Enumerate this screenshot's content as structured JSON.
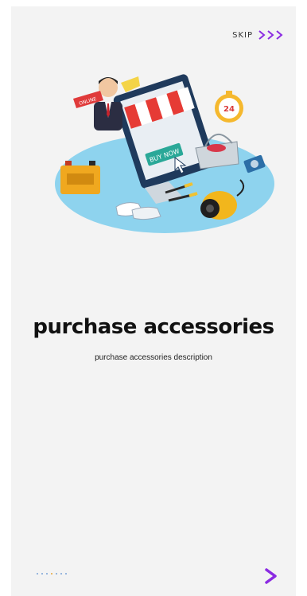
{
  "onboarding": {
    "skip_label": "SKIP",
    "title": "purchase accessories",
    "description": "purchase accessories description"
  },
  "illustration": {
    "online_tag": "ONLINE",
    "buy_now_label": "BUY NOW",
    "clock_number": "24"
  },
  "pagination": {
    "page_count": 7,
    "dot_colors": [
      "#7aa3d8",
      "#7aa3d8",
      "#7aa3d8",
      "#e6a73a",
      "#7aa3d8",
      "#7aa3d8",
      "#7aa3d8"
    ]
  },
  "colors": {
    "accent": "#8b2be2",
    "background": "#f3f3f3"
  },
  "icons": {
    "skip": "triple-chevron-right-icon",
    "next": "chevron-right-icon"
  }
}
